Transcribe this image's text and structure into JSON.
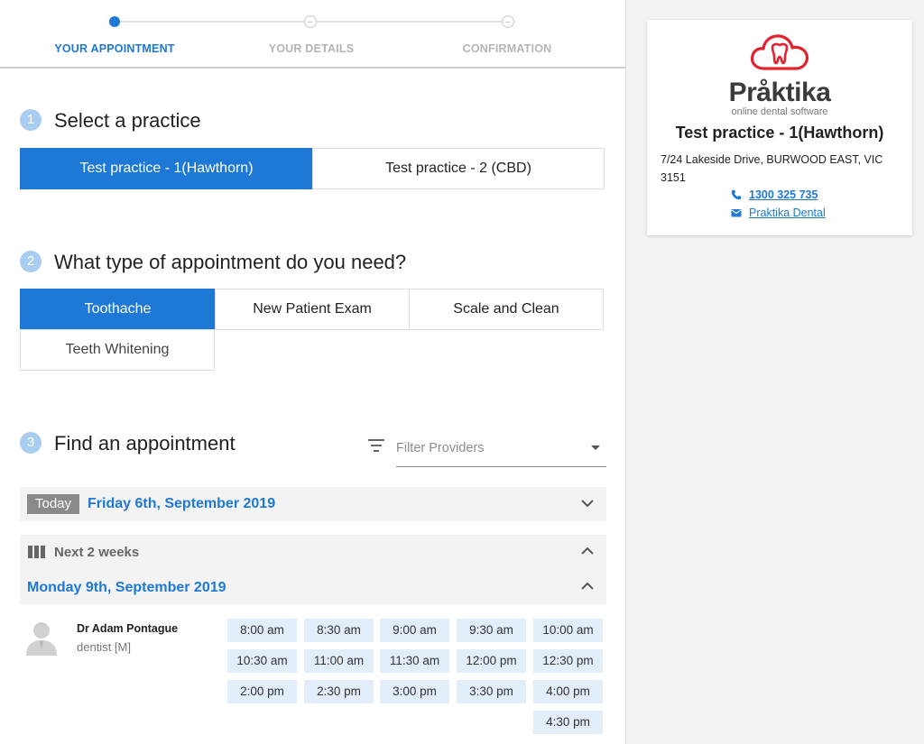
{
  "colors": {
    "accent": "#1e78d6",
    "brand_red": "#e2222e",
    "slot_bg": "#e1eefa"
  },
  "stepper": {
    "steps": [
      {
        "label": "YOUR APPOINTMENT",
        "state": "active"
      },
      {
        "label": "YOUR DETAILS",
        "state": "pending"
      },
      {
        "label": "CONFIRMATION",
        "state": "pending"
      }
    ]
  },
  "practice_section": {
    "number": "1",
    "title": "Select a practice",
    "options": [
      {
        "label": "Test practice - 1(Hawthorn)",
        "selected": true
      },
      {
        "label": "Test practice - 2 (CBD)",
        "selected": false
      }
    ]
  },
  "type_section": {
    "number": "2",
    "title": "What type of appointment do you need?",
    "options": [
      {
        "label": "Toothache",
        "selected": true
      },
      {
        "label": "New Patient Exam",
        "selected": false
      },
      {
        "label": "Scale and Clean",
        "selected": false
      },
      {
        "label": "Teeth Whitening",
        "selected": false
      }
    ]
  },
  "find_section": {
    "number": "3",
    "title": "Find an appointment",
    "filter": {
      "placeholder": "Filter Providers",
      "icon": "filter-icon"
    },
    "today": {
      "badge": "Today",
      "date": "Friday 6th, September 2019",
      "expanded": false
    },
    "next_weeks": {
      "label": "Next 2 weeks",
      "expanded": true,
      "day": {
        "date": "Monday 9th, September 2019",
        "expanded": true,
        "provider": {
          "name": "Dr Adam Pontague",
          "role": "dentist [M]",
          "slots": [
            "8:00 am",
            "8:30 am",
            "9:00 am",
            "9:30 am",
            "10:00 am",
            "10:30 am",
            "11:00 am",
            "11:30 am",
            "12:00 pm",
            "12:30 pm",
            "2:00 pm",
            "2:30 pm",
            "3:00 pm",
            "3:30 pm",
            "4:00 pm",
            "4:30 pm"
          ]
        }
      }
    }
  },
  "practice_card": {
    "brand": "Pråktika",
    "brand_tagline": "online dental software",
    "title": "Test practice - 1(Hawthorn)",
    "address": "7/24 Lakeside Drive, BURWOOD EAST, VIC 3151",
    "phone": "1300 325 735",
    "email_label": "Praktika Dental"
  }
}
